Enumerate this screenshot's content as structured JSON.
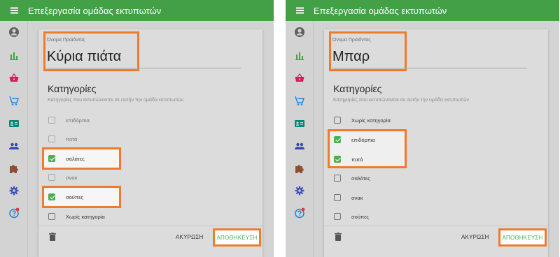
{
  "colors": {
    "accent_green": "#43a047",
    "highlight_orange": "#ef7b2e",
    "checkbox_green": "#4caf50"
  },
  "panels": [
    {
      "app_title": "Επεξεργασία ομάδας εκτυπωτών",
      "product_name_label": "Όνομα Προϊόντος",
      "product_name_value": "Κύρια πιάτα",
      "categories_title": "Κατηγορίες",
      "categories_desc": "Κατηγορίες που εκτυπώνονται σε αυτήν την ομάδα εκτυπωτών",
      "categories": [
        {
          "label": "επιδόρπια",
          "checked": false,
          "disabled": true
        },
        {
          "label": "ποτά",
          "checked": false,
          "disabled": true
        },
        {
          "label": "σαλάτες",
          "checked": true,
          "disabled": false
        },
        {
          "label": "σνακ",
          "checked": false,
          "disabled": true
        },
        {
          "label": "σούπες",
          "checked": true,
          "disabled": false
        },
        {
          "label": "Χωρίς κατηγορία",
          "checked": false,
          "disabled": false
        }
      ],
      "cancel_label": "ΑΚΥΡΩΣΗ",
      "save_label": "ΑΠΟΘΗΚΕΥΣΗ"
    },
    {
      "app_title": "Επεξεργασία ομάδας εκτυπωτών",
      "product_name_label": "Όνομα Προϊόντος",
      "product_name_value": "Μπαρ",
      "categories_title": "Κατηγορίες",
      "categories_desc": "Κατηγορίες που εκτυπώνονται σε αυτήν την ομάδα εκτυπωτών",
      "categories": [
        {
          "label": "Χωρίς κατηγορία",
          "checked": false,
          "disabled": false
        },
        {
          "label": "επιδόρπια",
          "checked": true,
          "disabled": false
        },
        {
          "label": "ποτά",
          "checked": true,
          "disabled": false
        },
        {
          "label": "σαλάτες",
          "checked": false,
          "disabled": false
        },
        {
          "label": "σνακ",
          "checked": false,
          "disabled": false
        },
        {
          "label": "σούπες",
          "checked": false,
          "disabled": false
        }
      ],
      "cancel_label": "ΑΚΥΡΩΣΗ",
      "save_label": "ΑΠΟΘΗΚΕΥΣΗ"
    }
  ],
  "sidebar_icons": [
    "account-circle-icon",
    "bar-chart-icon",
    "basket-icon",
    "cart-icon",
    "id-card-icon",
    "people-icon",
    "puzzle-icon",
    "settings-icon",
    "help-icon"
  ]
}
